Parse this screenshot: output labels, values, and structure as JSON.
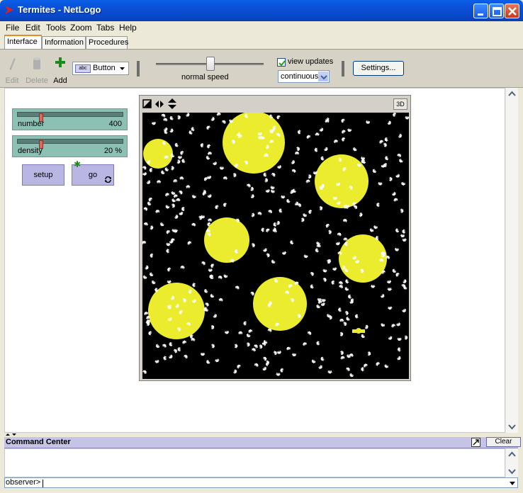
{
  "window": {
    "title": "Termites - NetLogo"
  },
  "menu": [
    "File",
    "Edit",
    "Tools",
    "Zoom",
    "Tabs",
    "Help"
  ],
  "tabs": [
    "Interface",
    "Information",
    "Procedures"
  ],
  "toolbar": {
    "edit_label": "Edit",
    "delete_label": "Delete",
    "add_label": "Add",
    "widget_type": "Button",
    "speed_label": "normal speed",
    "speed_fraction": 0.5,
    "view_updates_label": "view updates",
    "view_updates_checked": true,
    "update_mode": "continuous",
    "settings_label": "Settings..."
  },
  "widgets": {
    "number": {
      "name": "number",
      "value": "400"
    },
    "density": {
      "name": "density",
      "value": "20 %"
    },
    "setup_label": "setup",
    "go_label": "go"
  },
  "view": {
    "three_d_label": "3D"
  },
  "command_center": {
    "title": "Command Center",
    "clear_label": "Clear",
    "prompt": "observer>"
  },
  "colors": {
    "patch": "#ecec2e",
    "termite": "#ffffff",
    "slider": "#8dc0b5",
    "button": "#b9b6e3"
  }
}
